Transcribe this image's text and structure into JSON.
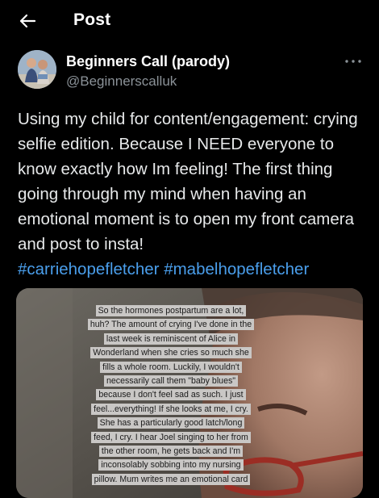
{
  "header": {
    "title": "Post"
  },
  "author": {
    "display_name": "Beginners Call (parody)",
    "handle": "@Beginnerscalluk"
  },
  "post": {
    "text": "Using my child for content/engagement: crying selfie edition. Because I NEED everyone to know exactly how Im feeling! The first thing going through my mind when having an emotional moment is to open my front camera and post to insta!",
    "hashtags": [
      "#carriehopefletcher",
      "#mabelhopefletcher"
    ]
  },
  "media": {
    "caption_lines": [
      "So the hormones postpartum are a lot,",
      "huh? The amount of crying I've done in the",
      "last week is reminiscent of Alice in",
      "Wonderland when she cries so much she",
      "fills a whole room. Luckily, I wouldn't",
      "necessarily call them \"baby blues\"",
      "because I don't feel sad as such. I just",
      "feel...everything! If she looks at me, I cry.",
      "She has a particularly good latch/long",
      "feed, I cry. I hear Joel singing to her from",
      "the other room, he gets back and I'm",
      "inconsolably sobbing into my nursing",
      "pillow. Mum writes me an emotional card"
    ]
  },
  "icons": {
    "back": "arrow-left-icon",
    "more": "more-horizontal-icon"
  },
  "colors": {
    "background": "#000000",
    "text": "#e7e9ea",
    "secondary_text": "#8b9298",
    "link": "#4a9eeb"
  }
}
